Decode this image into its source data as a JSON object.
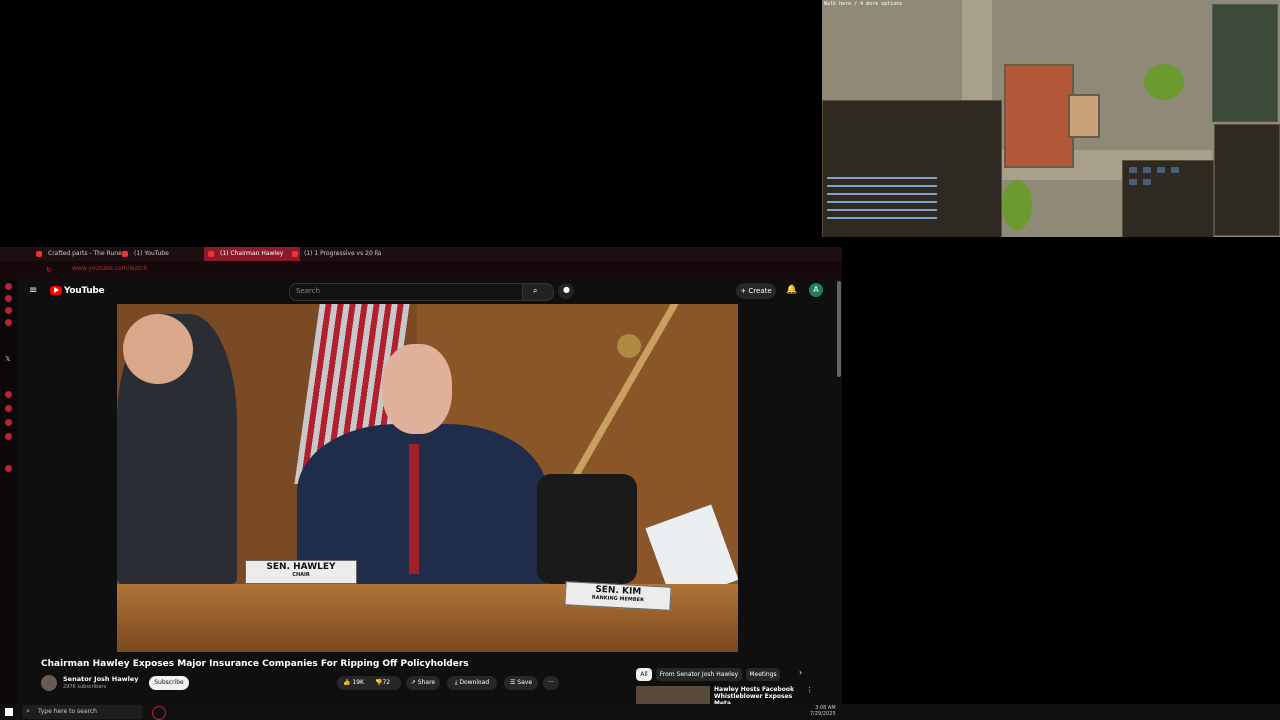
{
  "game": {
    "title": "Walk here / 4 more options"
  },
  "browser": {
    "tabs": [
      {
        "label": "Crafted parts - The Rune"
      },
      {
        "label": "(1) YouTube"
      },
      {
        "label": "(1) Chairman Hawley"
      },
      {
        "label": "(1) 1 Progressive vs 20 Fa"
      }
    ],
    "url": "www.youtube.com/watch"
  },
  "youtube": {
    "logo": "YouTube",
    "search_placeholder": "Search",
    "create_label": "Create",
    "avatar_letter": "A",
    "video": {
      "nameplate_left_name": "SEN. HAWLEY",
      "nameplate_left_role": "CHAIR",
      "nameplate_right_name": "SEN. KIM",
      "nameplate_right_role": "RANKING MEMBER"
    },
    "title": "Chairman Hawley Exposes Major Insurance Companies For Ripping Off Policyholders",
    "channel_name": "Senator Josh Hawley",
    "channel_subs": "297K subscribers",
    "subscribe_label": "Subscribe",
    "likes": "19K",
    "dislikes": "72",
    "share_label": "Share",
    "download_label": "Download",
    "save_label": "Save",
    "more_label": "···",
    "chips": [
      "All",
      "From Senator Josh Hawley",
      "Meetings"
    ],
    "rec_title": "Hawley Hosts Facebook Whistleblower Exposes Meta"
  },
  "taskbar": {
    "search_placeholder": "Type here to search",
    "time": "3:08 AM",
    "date": "7/29/2025"
  },
  "colors": {
    "accent": "#b5253a",
    "youtube_red": "#ff0000"
  }
}
